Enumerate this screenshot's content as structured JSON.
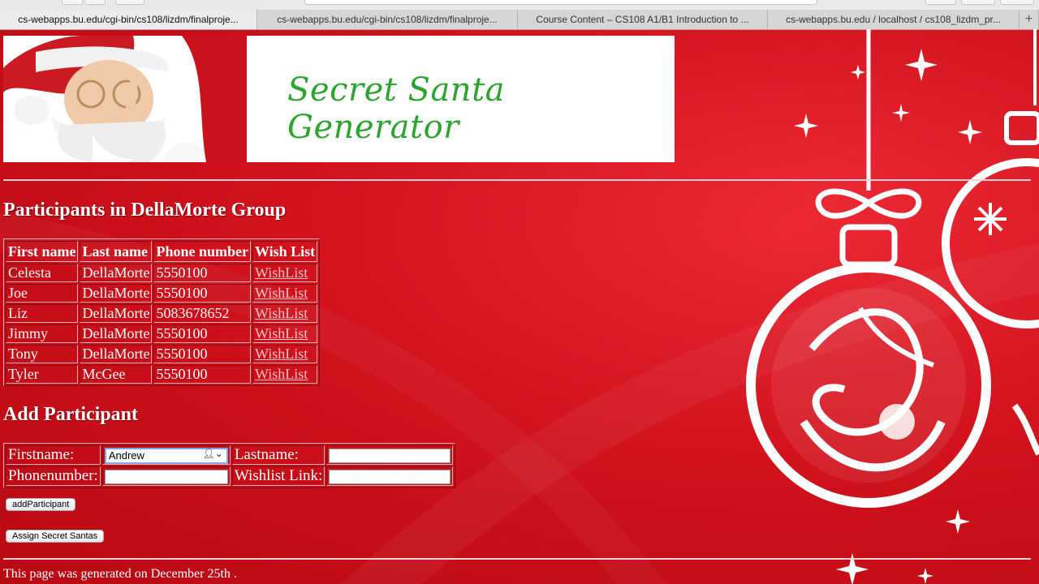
{
  "browser": {
    "tabs": [
      {
        "label": "cs-webapps.bu.edu/cgi-bin/cs108/lizdm/finalproje...",
        "active": true
      },
      {
        "label": "cs-webapps.bu.edu/cgi-bin/cs108/lizdm/finalproje...",
        "active": false
      },
      {
        "label": "Course Content – CS108 A1/B1 Introduction to ...",
        "active": false
      },
      {
        "label": "cs-webapps.bu.edu / localhost / cs108_lizdm_pr...",
        "active": false
      }
    ],
    "new_tab_label": "+"
  },
  "banner": {
    "title": "Secret Santa Generator"
  },
  "participants": {
    "heading": "Participants in DellaMorte Group",
    "columns": [
      "First name",
      "Last name",
      "Phone number",
      "Wish List"
    ],
    "rows": [
      {
        "first": "Celesta",
        "last": "DellaMorte",
        "phone": "5550100",
        "wishlist": "WishList"
      },
      {
        "first": "Joe",
        "last": "DellaMorte",
        "phone": "5550100",
        "wishlist": "WishList"
      },
      {
        "first": "Liz",
        "last": "DellaMorte",
        "phone": "5083678652",
        "wishlist": "WishList"
      },
      {
        "first": "Jimmy",
        "last": "DellaMorte",
        "phone": "5550100",
        "wishlist": "WishList"
      },
      {
        "first": "Tony",
        "last": "DellaMorte",
        "phone": "5550100",
        "wishlist": "WishList"
      },
      {
        "first": "Tyler",
        "last": "McGee",
        "phone": "5550100",
        "wishlist": "WishList"
      }
    ]
  },
  "add_form": {
    "heading": "Add Participant",
    "firstname_label": "Firstname:",
    "firstname_value": "Andrew",
    "lastname_label": "Lastname:",
    "lastname_value": "",
    "phone_label": "Phonenumber:",
    "phone_value": "",
    "wishlist_label": "Wishlist Link:",
    "wishlist_value": "",
    "submit_label": "addParticipant"
  },
  "assign_button_label": "Assign Secret Santas",
  "footer": "This page was generated on December 25th .",
  "colors": {
    "background": "#d4111c",
    "title_green": "#2aa52e"
  }
}
